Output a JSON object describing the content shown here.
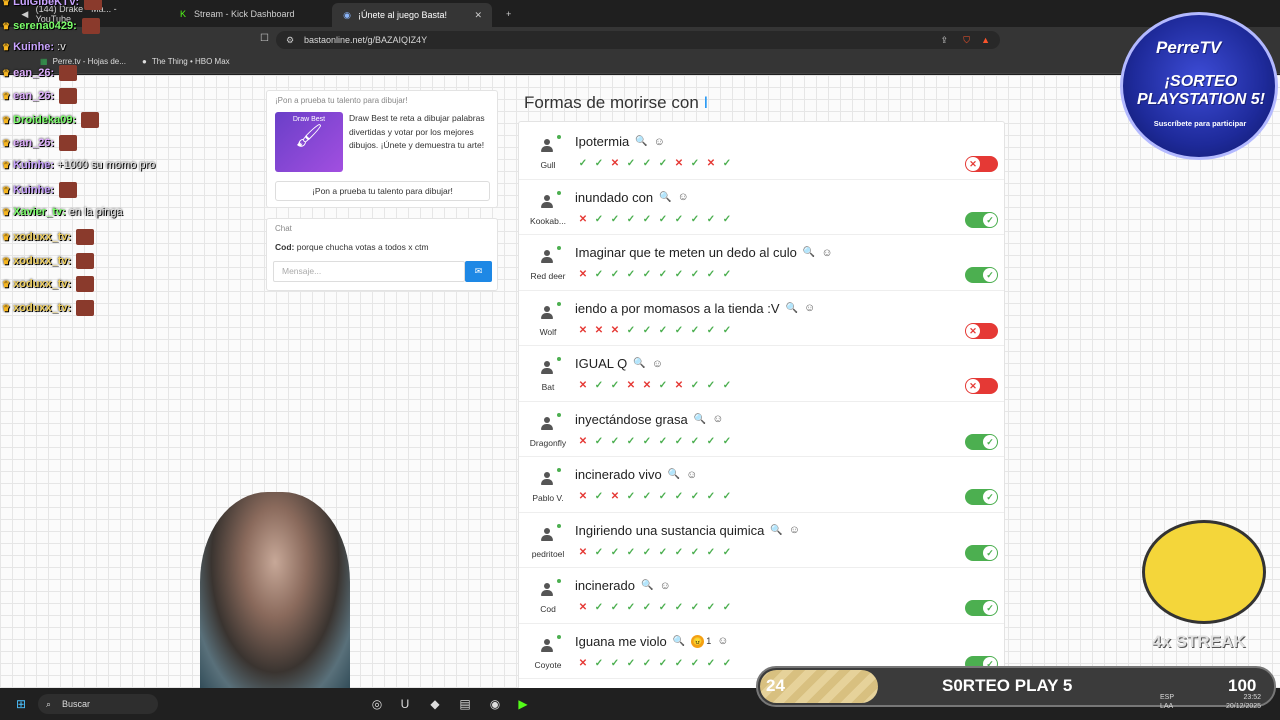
{
  "browser": {
    "tabs": [
      {
        "label": "(144) Drake - Ma... - YouTube",
        "active": false
      },
      {
        "label": "Stream - Kick Dashboard",
        "active": false
      },
      {
        "label": "¡Únete al juego Basta!",
        "active": true
      }
    ],
    "url": "bastaonline.net/g/BAZAIQIZ4Y",
    "bookmarks": [
      "Perre.tv - Hojas de...",
      "The Thing • HBO Max"
    ]
  },
  "promo": {
    "title": "¡Pon a prueba tu talento para dibujar!",
    "image_caption": "Draw Best",
    "text": "Draw Best te reta a dibujar palabras divertidas y votar por los mejores dibujos. ¡Únete y demuestra tu arte!",
    "button": "¡Pon a prueba tu talento para dibujar!"
  },
  "chat": {
    "title": "Chat",
    "message_author": "Cod:",
    "message_text": " porque chucha votas a todos x ctm",
    "placeholder": "Mensaje..."
  },
  "category": {
    "title": "Formas de morirse con",
    "letter": "I"
  },
  "answers": [
    {
      "player": "Gull",
      "text": "Ipotermia",
      "votes": [
        "ok",
        "ok",
        "no",
        "ok",
        "ok",
        "ok",
        "no",
        "ok",
        "no",
        "ok"
      ],
      "valid": false
    },
    {
      "player": "Kookab...",
      "text": "inundado con",
      "votes": [
        "no",
        "ok",
        "ok",
        "ok",
        "ok",
        "ok",
        "ok",
        "ok",
        "ok",
        "ok"
      ],
      "valid": true
    },
    {
      "player": "Red deer",
      "text": "Imaginar que te meten un dedo al culo",
      "votes": [
        "no",
        "ok",
        "ok",
        "ok",
        "ok",
        "ok",
        "ok",
        "ok",
        "ok",
        "ok"
      ],
      "valid": true
    },
    {
      "player": "Wolf",
      "text": "iendo a por momasos a la tienda :V",
      "votes": [
        "no",
        "no",
        "no",
        "ok",
        "ok",
        "ok",
        "ok",
        "ok",
        "ok",
        "ok"
      ],
      "valid": false
    },
    {
      "player": "Bat",
      "text": "IGUAL Q",
      "votes": [
        "no",
        "ok",
        "ok",
        "no",
        "no",
        "ok",
        "no",
        "ok",
        "ok",
        "ok"
      ],
      "valid": false
    },
    {
      "player": "Dragonfly",
      "text": "inyectándose grasa",
      "votes": [
        "no",
        "ok",
        "ok",
        "ok",
        "ok",
        "ok",
        "ok",
        "ok",
        "ok",
        "ok"
      ],
      "valid": true
    },
    {
      "player": "Pablo V.",
      "text": "incinerado vivo",
      "votes": [
        "no",
        "ok",
        "no",
        "ok",
        "ok",
        "ok",
        "ok",
        "ok",
        "ok",
        "ok"
      ],
      "valid": true
    },
    {
      "player": "pedritoel",
      "text": "Ingiriendo una sustancia quimica",
      "votes": [
        "no",
        "ok",
        "ok",
        "ok",
        "ok",
        "ok",
        "ok",
        "ok",
        "ok",
        "ok"
      ],
      "valid": true
    },
    {
      "player": "Cod",
      "text": "incinerado",
      "votes": [
        "no",
        "ok",
        "ok",
        "ok",
        "ok",
        "ok",
        "ok",
        "ok",
        "ok",
        "ok"
      ],
      "valid": true
    },
    {
      "player": "Coyote",
      "text": "Iguana me violo",
      "votes": [
        "no",
        "ok",
        "ok",
        "ok",
        "ok",
        "ok",
        "ok",
        "ok",
        "ok",
        "ok"
      ],
      "valid": true,
      "reaction_count": "1"
    }
  ],
  "stream_chat": [
    {
      "user": "LuiGibeKTV:",
      "color": "#c9a3ff",
      "msg": ""
    },
    {
      "user": "serena0429:",
      "color": "#7cff6b",
      "msg": ""
    },
    {
      "user": "Kuinhe:",
      "color": "#c9a3ff",
      "msg": ":v"
    },
    {
      "user": "ean_26:",
      "color": "#e0b0ff",
      "msg": ""
    },
    {
      "user": "ean_26:",
      "color": "#e0b0ff",
      "msg": ""
    },
    {
      "user": "Droideka09:",
      "color": "#7cff6b",
      "msg": ""
    },
    {
      "user": "ean_26:",
      "color": "#e0b0ff",
      "msg": ""
    },
    {
      "user": "Kuinhe:",
      "color": "#c9a3ff",
      "msg": "+1000 su momo pro"
    },
    {
      "user": "Kuinhe:",
      "color": "#c9a3ff",
      "msg": ""
    },
    {
      "user": "Xavier_tv:",
      "color": "#7cff6b",
      "msg": "en la pinga"
    },
    {
      "user": "xoduxx_tv:",
      "color": "#f0d060",
      "msg": ""
    },
    {
      "user": "xoduxx_tv:",
      "color": "#f0d060",
      "msg": ""
    },
    {
      "user": "xoduxx_tv:",
      "color": "#f0d060",
      "msg": ""
    },
    {
      "user": "xoduxx_tv:",
      "color": "#f0d060",
      "msg": ""
    }
  ],
  "badge": {
    "brand": "PerreTV",
    "headline": "¡SORTEO PLAYSTATION 5!",
    "sub": "Suscríbete para participar"
  },
  "streak": "4x STREAK",
  "giveaway": {
    "current": "24",
    "label": "S0RTEO PLAY 5",
    "goal": "100",
    "progress": 0.24
  },
  "taskbar": {
    "search": "Buscar",
    "lang": "ESP",
    "region": "LAA",
    "time": "23:52",
    "date": "20/12/2025"
  }
}
